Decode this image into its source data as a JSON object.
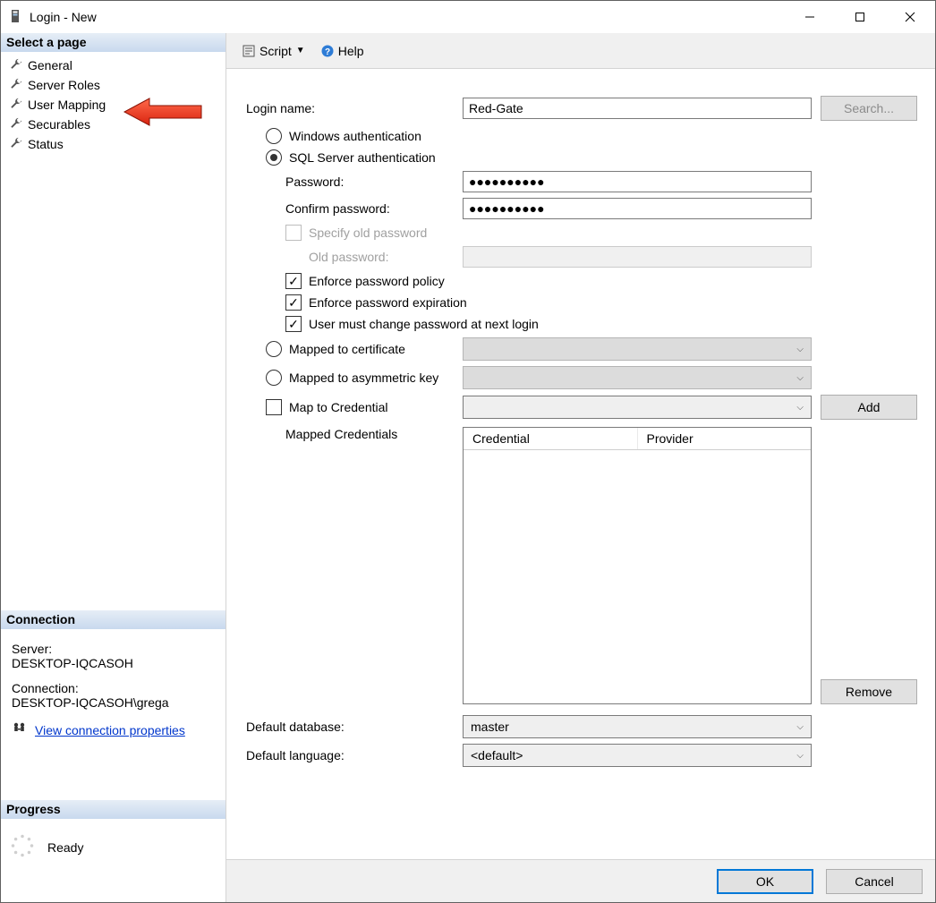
{
  "window": {
    "title": "Login - New"
  },
  "sidebar": {
    "header": "Select a page",
    "items": [
      {
        "label": "General"
      },
      {
        "label": "Server Roles"
      },
      {
        "label": "User Mapping"
      },
      {
        "label": "Securables"
      },
      {
        "label": "Status"
      }
    ]
  },
  "connection": {
    "header": "Connection",
    "server_label": "Server:",
    "server_value": "DESKTOP-IQCASOH",
    "conn_label": "Connection:",
    "conn_value": "DESKTOP-IQCASOH\\grega",
    "link": "View connection properties"
  },
  "progress": {
    "header": "Progress",
    "status": "Ready"
  },
  "toolbar": {
    "script": "Script",
    "help": "Help"
  },
  "form": {
    "login_name_label": "Login name:",
    "login_name_value": "Red-Gate",
    "search_btn": "Search...",
    "radio_windows": "Windows authentication",
    "radio_sql": "SQL Server authentication",
    "password_label": "Password:",
    "password_value": "●●●●●●●●●●",
    "confirm_label": "Confirm password:",
    "confirm_value": "●●●●●●●●●●",
    "specify_old": "Specify old password",
    "old_password_label": "Old password:",
    "enforce_policy": "Enforce password policy",
    "enforce_expiration": "Enforce password expiration",
    "must_change": "User must change password at next login",
    "mapped_cert": "Mapped to certificate",
    "mapped_asym": "Mapped to asymmetric key",
    "map_cred": "Map to Credential",
    "add_btn": "Add",
    "mapped_credentials": "Mapped Credentials",
    "col_credential": "Credential",
    "col_provider": "Provider",
    "remove_btn": "Remove",
    "default_db_label": "Default database:",
    "default_db_value": "master",
    "default_lang_label": "Default language:",
    "default_lang_value": "<default>"
  },
  "footer": {
    "ok": "OK",
    "cancel": "Cancel"
  }
}
